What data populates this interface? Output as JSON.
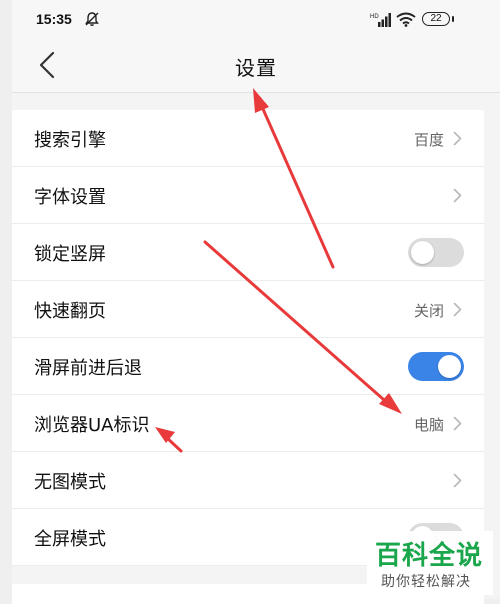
{
  "status_bar": {
    "time": "15:35",
    "battery": "22",
    "icons": [
      "bell-off-icon",
      "signal-icon",
      "wifi-icon",
      "battery-icon"
    ]
  },
  "nav": {
    "title": "设置",
    "back_icon": "chevron-left-icon"
  },
  "settings": [
    {
      "label": "搜索引擎",
      "control": "value",
      "value": "百度"
    },
    {
      "label": "字体设置",
      "control": "chevron",
      "value": ""
    },
    {
      "label": "锁定竖屏",
      "control": "toggle",
      "toggle_on": false
    },
    {
      "label": "快速翻页",
      "control": "value",
      "value": "关闭"
    },
    {
      "label": "滑屏前进后退",
      "control": "toggle",
      "toggle_on": true
    },
    {
      "label": "浏览器UA标识",
      "control": "value",
      "value": "电脑"
    },
    {
      "label": "无图模式",
      "control": "chevron",
      "value": ""
    },
    {
      "label": "全屏模式",
      "control": "toggle",
      "toggle_on": false
    }
  ],
  "colors": {
    "toggle_on": "#3a84e8",
    "toggle_off": "#dcdcdc",
    "annotation_arrow": "#e8393b",
    "watermark": "#1aa64b"
  },
  "watermark": {
    "title": "百科全说",
    "subtitle": "助你轻松解决"
  }
}
